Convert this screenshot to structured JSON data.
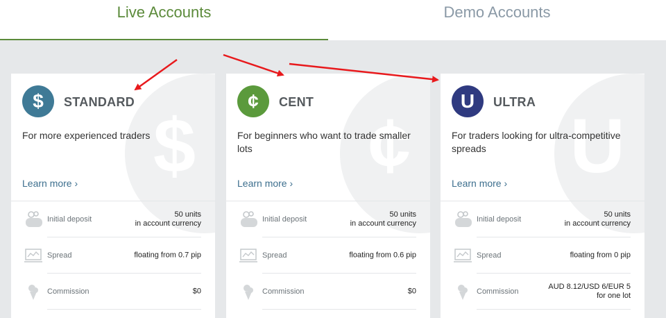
{
  "tabs": [
    {
      "label": "Live Accounts",
      "active": true
    },
    {
      "label": "Demo Accounts",
      "active": false
    }
  ],
  "cards": [
    {
      "icon_symbol": "$",
      "icon_name": "dollar-icon",
      "icon_color": "#3f7a96",
      "title": "STANDARD",
      "description": "For more experienced traders",
      "learn_more": "Learn more ›",
      "rows": [
        {
          "icon": "wallet-icon",
          "label": "Initial deposit",
          "value": "50 units\nin account currency"
        },
        {
          "icon": "chart-icon",
          "label": "Spread",
          "value": "floating from 0.7 pip"
        },
        {
          "icon": "ice-cream-icon",
          "label": "Commission",
          "value": "$0"
        }
      ]
    },
    {
      "icon_symbol": "¢",
      "icon_name": "cent-icon",
      "icon_color": "#5b9a3c",
      "title": "CENT",
      "description": "For beginners who want to trade smaller lots",
      "learn_more": "Learn more ›",
      "rows": [
        {
          "icon": "wallet-icon",
          "label": "Initial deposit",
          "value": "50 units\nin account currency"
        },
        {
          "icon": "chart-icon",
          "label": "Spread",
          "value": "floating from 0.6 pip"
        },
        {
          "icon": "ice-cream-icon",
          "label": "Commission",
          "value": "$0"
        }
      ]
    },
    {
      "icon_symbol": "U",
      "icon_name": "ultra-icon",
      "icon_color": "#2f3a80",
      "title": "ULTRA",
      "description": "For traders looking for ultra-competitive spreads",
      "learn_more": "Learn more ›",
      "rows": [
        {
          "icon": "wallet-icon",
          "label": "Initial deposit",
          "value": "50 units\nin account currency"
        },
        {
          "icon": "chart-icon",
          "label": "Spread",
          "value": "floating from 0 pip"
        },
        {
          "icon": "ice-cream-icon",
          "label": "Commission",
          "value": "AUD 8.12/USD 6/EUR 5\nfor one lot"
        }
      ]
    }
  ],
  "colors": {
    "active_tab": "#5b8a3a",
    "inactive_tab": "#8a99a6",
    "annotation_arrow": "#e8191c"
  }
}
